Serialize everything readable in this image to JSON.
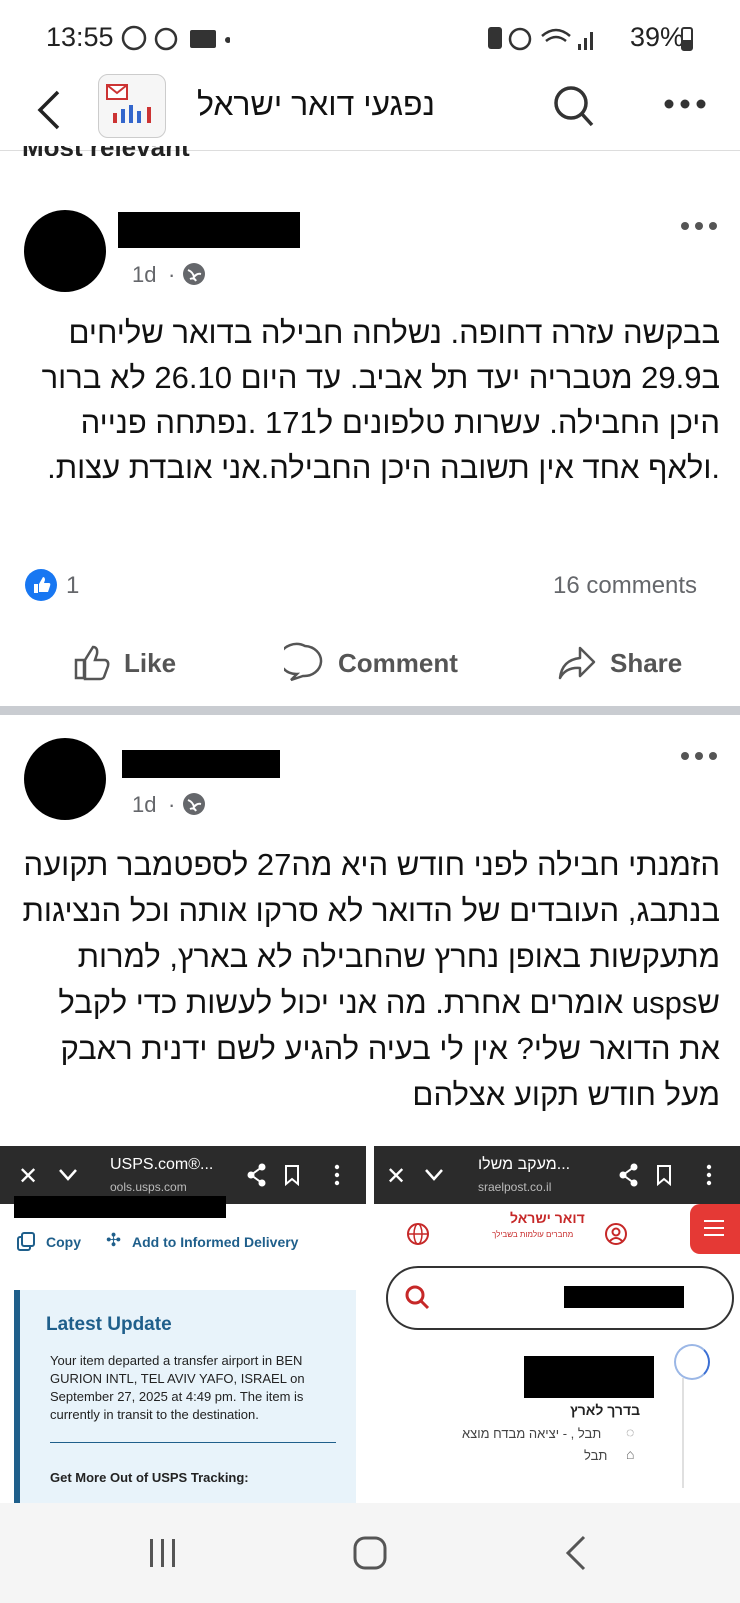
{
  "status_bar": {
    "time": "13:55",
    "battery": "39%"
  },
  "header": {
    "title": "נפגעי דואר ישראל"
  },
  "feed": {
    "cutoff_label": "Most relevant"
  },
  "posts": [
    {
      "time": "1d",
      "body": "בבקשה עזרה דחופה. נשלחה חבילה בדואר שליחים ב29.9  מטבריה יעד תל אביב. עד היום 26.10 לא ברור היכן החבילה. עשרות טלפונים ל171 .נפתחה פנייה .ולאף אחד אין תשובה היכן החבילה.אני אובדת עצות.",
      "reaction_count": "1",
      "comments": "16 comments",
      "actions": {
        "like": "Like",
        "comment": "Comment",
        "share": "Share"
      }
    },
    {
      "time": "1d",
      "body": "הזמנתי חבילה לפני חודש היא מה27 לספטמבר תקועה בנתבג, העובדים של  הדואר לא סרקו אותה וכל הנציגות מתעקשות באופן נחרץ שהחבילה לא בארץ, למרות שusps אומרים אחרת. מה אני יכול לעשות כדי לקבל את הדואר שלי? אין לי בעיה להגיע לשם ידנית ראבק מעל חודש תקוע אצלהם"
    }
  ],
  "usps_shot": {
    "tab_title": "USPS.com®...",
    "url": "ools.usps.com",
    "copy": "Copy",
    "informed_delivery": "Add to Informed Delivery",
    "latest_update_title": "Latest Update",
    "latest_update_text": "Your item departed a transfer airport in BEN GURION INTL, TEL AVIV YAFO, ISRAEL on September 27, 2025 at 4:49 pm. The item is currently in transit to the destination.",
    "get_more": "Get More Out of USPS Tracking:"
  },
  "israelpost_shot": {
    "tab_title": "מעקב משלו...",
    "url": "sraelpost.co.il",
    "logo_text": "דואר ישראל",
    "logo_tagline": "מחברים עולמות בשבילך",
    "status": "בדרך לארץ",
    "event1": "תבל , - יציאה מבדח מוצא",
    "event2": "תבל"
  },
  "colors": {
    "facebook_blue": "#1877f2",
    "usps_blue": "#1f5f8b",
    "israel_post_red": "#e53935"
  }
}
